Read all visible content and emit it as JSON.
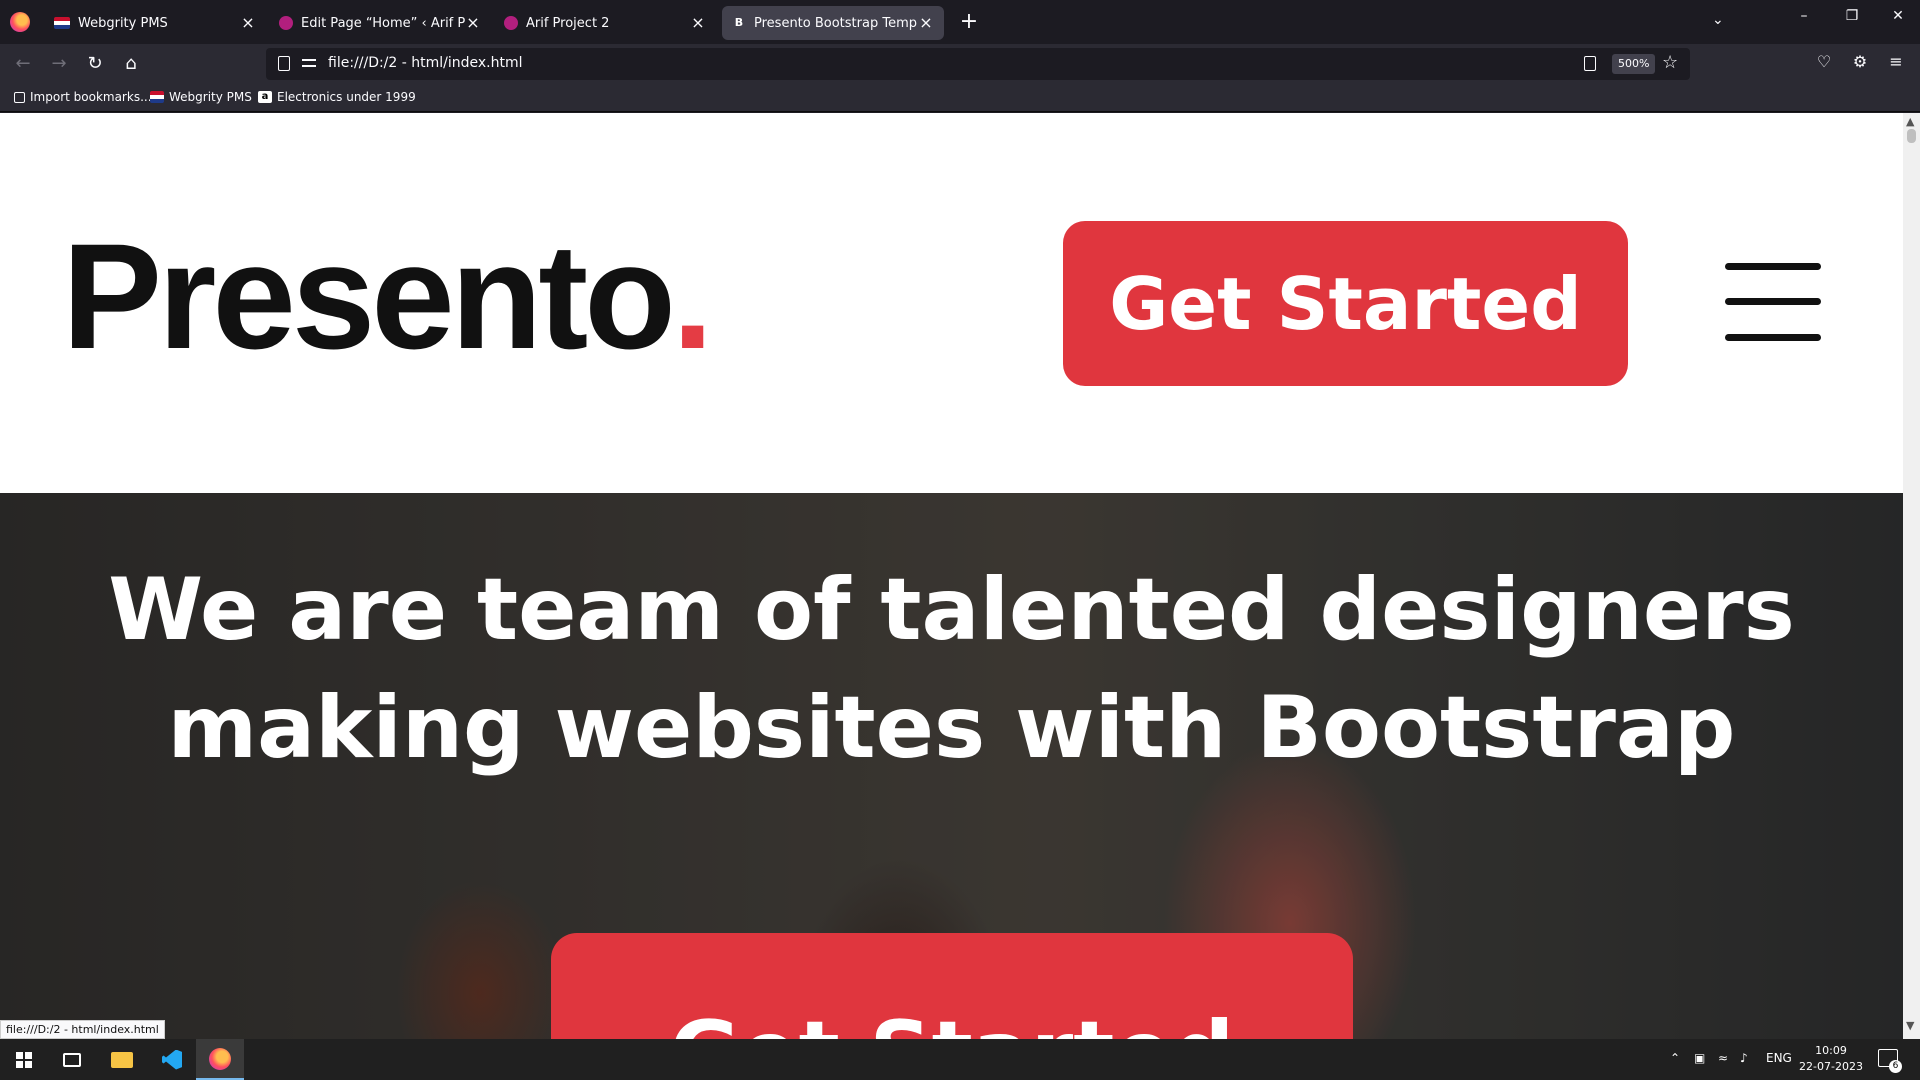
{
  "browser": {
    "tabs": [
      {
        "title": "Webgrity PMS",
        "icon": "flag-icon"
      },
      {
        "title": "Edit Page “Home” ‹ Arif Project",
        "icon": "wordpress-icon"
      },
      {
        "title": "Arif Project 2",
        "icon": "wordpress-icon"
      },
      {
        "title": "Presento Bootstrap Template - I",
        "icon": "bootstrap-icon",
        "active": true
      }
    ],
    "bootstrap_glyph": "B",
    "amazon_glyph": "a",
    "url": "file:///D:/2 - html/index.html",
    "zoom": "500%",
    "bookmarks": [
      {
        "label": "Import bookmarks..."
      },
      {
        "label": "Webgrity PMS"
      },
      {
        "label": "Electronics under 1999"
      }
    ],
    "status_url": "file:///D:/2 - html/index.html"
  },
  "page": {
    "logo_text": "Presento",
    "logo_dot": ".",
    "header_cta": "Get Started",
    "hero_line1": "We are team of talented designers",
    "hero_line2": "making websites with Bootstrap",
    "hero_cta": "Get Started",
    "accent_color": "#e0363e"
  },
  "taskbar": {
    "language": "ENG",
    "time": "10:09",
    "date": "22-07-2023",
    "notification_count": "6"
  }
}
